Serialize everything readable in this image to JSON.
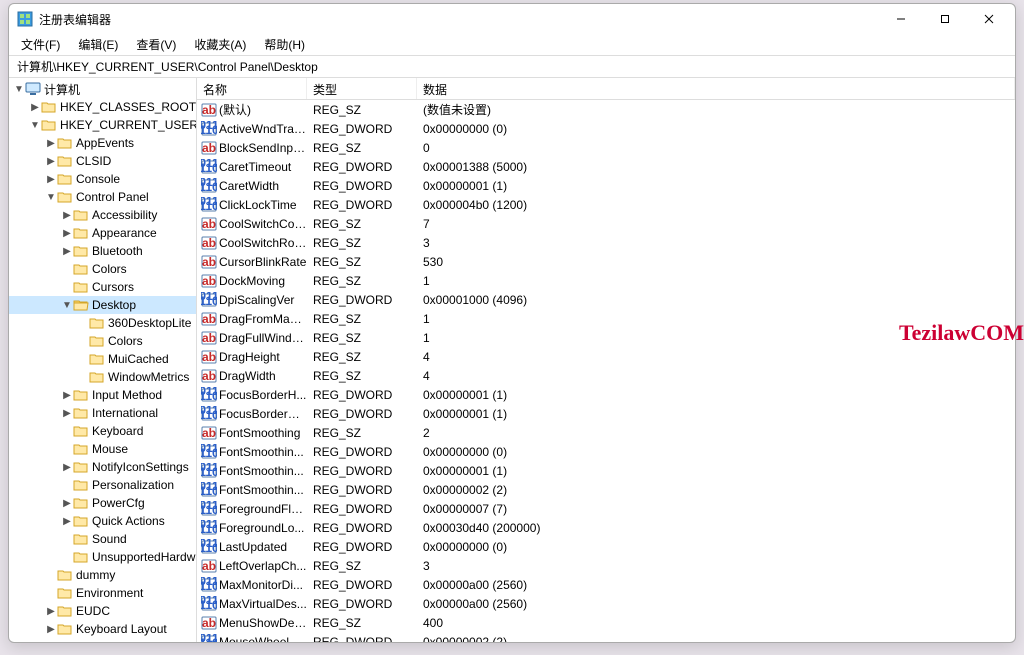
{
  "window": {
    "title": "注册表编辑器"
  },
  "menu": {
    "items": [
      "文件(F)",
      "编辑(E)",
      "查看(V)",
      "收藏夹(A)",
      "帮助(H)"
    ]
  },
  "address": "计算机\\HKEY_CURRENT_USER\\Control Panel\\Desktop",
  "tree": [
    {
      "label": "计算机",
      "depth": 0,
      "chev": "down",
      "icon": "pc"
    },
    {
      "label": "HKEY_CLASSES_ROOT",
      "depth": 1,
      "chev": "right",
      "icon": "folder"
    },
    {
      "label": "HKEY_CURRENT_USER",
      "depth": 1,
      "chev": "down",
      "icon": "folder"
    },
    {
      "label": "AppEvents",
      "depth": 2,
      "chev": "right",
      "icon": "folder"
    },
    {
      "label": "CLSID",
      "depth": 2,
      "chev": "right",
      "icon": "folder"
    },
    {
      "label": "Console",
      "depth": 2,
      "chev": "right",
      "icon": "folder"
    },
    {
      "label": "Control Panel",
      "depth": 2,
      "chev": "down",
      "icon": "folder"
    },
    {
      "label": "Accessibility",
      "depth": 3,
      "chev": "right",
      "icon": "folder"
    },
    {
      "label": "Appearance",
      "depth": 3,
      "chev": "right",
      "icon": "folder"
    },
    {
      "label": "Bluetooth",
      "depth": 3,
      "chev": "right",
      "icon": "folder"
    },
    {
      "label": "Colors",
      "depth": 3,
      "chev": "",
      "icon": "folder"
    },
    {
      "label": "Cursors",
      "depth": 3,
      "chev": "",
      "icon": "folder"
    },
    {
      "label": "Desktop",
      "depth": 3,
      "chev": "down",
      "icon": "folder-open",
      "sel": true
    },
    {
      "label": "360DesktopLite",
      "depth": 4,
      "chev": "",
      "icon": "folder"
    },
    {
      "label": "Colors",
      "depth": 4,
      "chev": "",
      "icon": "folder"
    },
    {
      "label": "MuiCached",
      "depth": 4,
      "chev": "",
      "icon": "folder"
    },
    {
      "label": "WindowMetrics",
      "depth": 4,
      "chev": "",
      "icon": "folder"
    },
    {
      "label": "Input Method",
      "depth": 3,
      "chev": "right",
      "icon": "folder"
    },
    {
      "label": "International",
      "depth": 3,
      "chev": "right",
      "icon": "folder"
    },
    {
      "label": "Keyboard",
      "depth": 3,
      "chev": "",
      "icon": "folder"
    },
    {
      "label": "Mouse",
      "depth": 3,
      "chev": "",
      "icon": "folder"
    },
    {
      "label": "NotifyIconSettings",
      "depth": 3,
      "chev": "right",
      "icon": "folder"
    },
    {
      "label": "Personalization",
      "depth": 3,
      "chev": "",
      "icon": "folder"
    },
    {
      "label": "PowerCfg",
      "depth": 3,
      "chev": "right",
      "icon": "folder"
    },
    {
      "label": "Quick Actions",
      "depth": 3,
      "chev": "right",
      "icon": "folder"
    },
    {
      "label": "Sound",
      "depth": 3,
      "chev": "",
      "icon": "folder"
    },
    {
      "label": "UnsupportedHardwareNotificationCache",
      "depth": 3,
      "chev": "",
      "icon": "folder"
    },
    {
      "label": "dummy",
      "depth": 2,
      "chev": "",
      "icon": "folder"
    },
    {
      "label": "Environment",
      "depth": 2,
      "chev": "",
      "icon": "folder"
    },
    {
      "label": "EUDC",
      "depth": 2,
      "chev": "right",
      "icon": "folder"
    },
    {
      "label": "Keyboard Layout",
      "depth": 2,
      "chev": "right",
      "icon": "folder"
    }
  ],
  "columns": {
    "name": "名称",
    "type": "类型",
    "data": "数据"
  },
  "values": [
    {
      "name": "(默认)",
      "type": "REG_SZ",
      "data": "(数值未设置)",
      "icon": "sz"
    },
    {
      "name": "ActiveWndTrac...",
      "type": "REG_DWORD",
      "data": "0x00000000 (0)",
      "icon": "bin"
    },
    {
      "name": "BlockSendInpu...",
      "type": "REG_SZ",
      "data": "0",
      "icon": "sz"
    },
    {
      "name": "CaretTimeout",
      "type": "REG_DWORD",
      "data": "0x00001388 (5000)",
      "icon": "bin"
    },
    {
      "name": "CaretWidth",
      "type": "REG_DWORD",
      "data": "0x00000001 (1)",
      "icon": "bin"
    },
    {
      "name": "ClickLockTime",
      "type": "REG_DWORD",
      "data": "0x000004b0 (1200)",
      "icon": "bin"
    },
    {
      "name": "CoolSwitchCol...",
      "type": "REG_SZ",
      "data": "7",
      "icon": "sz"
    },
    {
      "name": "CoolSwitchRows",
      "type": "REG_SZ",
      "data": "3",
      "icon": "sz"
    },
    {
      "name": "CursorBlinkRate",
      "type": "REG_SZ",
      "data": "530",
      "icon": "sz"
    },
    {
      "name": "DockMoving",
      "type": "REG_SZ",
      "data": "1",
      "icon": "sz"
    },
    {
      "name": "DpiScalingVer",
      "type": "REG_DWORD",
      "data": "0x00001000 (4096)",
      "icon": "bin"
    },
    {
      "name": "DragFromMaxi...",
      "type": "REG_SZ",
      "data": "1",
      "icon": "sz"
    },
    {
      "name": "DragFullWindo...",
      "type": "REG_SZ",
      "data": "1",
      "icon": "sz"
    },
    {
      "name": "DragHeight",
      "type": "REG_SZ",
      "data": "4",
      "icon": "sz"
    },
    {
      "name": "DragWidth",
      "type": "REG_SZ",
      "data": "4",
      "icon": "sz"
    },
    {
      "name": "FocusBorderH...",
      "type": "REG_DWORD",
      "data": "0x00000001 (1)",
      "icon": "bin"
    },
    {
      "name": "FocusBorderW...",
      "type": "REG_DWORD",
      "data": "0x00000001 (1)",
      "icon": "bin"
    },
    {
      "name": "FontSmoothing",
      "type": "REG_SZ",
      "data": "2",
      "icon": "sz"
    },
    {
      "name": "FontSmoothin...",
      "type": "REG_DWORD",
      "data": "0x00000000 (0)",
      "icon": "bin"
    },
    {
      "name": "FontSmoothin...",
      "type": "REG_DWORD",
      "data": "0x00000001 (1)",
      "icon": "bin"
    },
    {
      "name": "FontSmoothin...",
      "type": "REG_DWORD",
      "data": "0x00000002 (2)",
      "icon": "bin"
    },
    {
      "name": "ForegroundFla...",
      "type": "REG_DWORD",
      "data": "0x00000007 (7)",
      "icon": "bin"
    },
    {
      "name": "ForegroundLo...",
      "type": "REG_DWORD",
      "data": "0x00030d40 (200000)",
      "icon": "bin"
    },
    {
      "name": "LastUpdated",
      "type": "REG_DWORD",
      "data": "0x00000000 (0)",
      "icon": "bin"
    },
    {
      "name": "LeftOverlapCh...",
      "type": "REG_SZ",
      "data": "3",
      "icon": "sz"
    },
    {
      "name": "MaxMonitorDi...",
      "type": "REG_DWORD",
      "data": "0x00000a00 (2560)",
      "icon": "bin"
    },
    {
      "name": "MaxVirtualDes...",
      "type": "REG_DWORD",
      "data": "0x00000a00 (2560)",
      "icon": "bin"
    },
    {
      "name": "MenuShowDelay",
      "type": "REG_SZ",
      "data": "400",
      "icon": "sz"
    },
    {
      "name": "MouseWheelR...",
      "type": "REG_DWORD",
      "data": "0x00000002 (2)",
      "icon": "bin"
    }
  ],
  "watermark": "TezilawCOM"
}
